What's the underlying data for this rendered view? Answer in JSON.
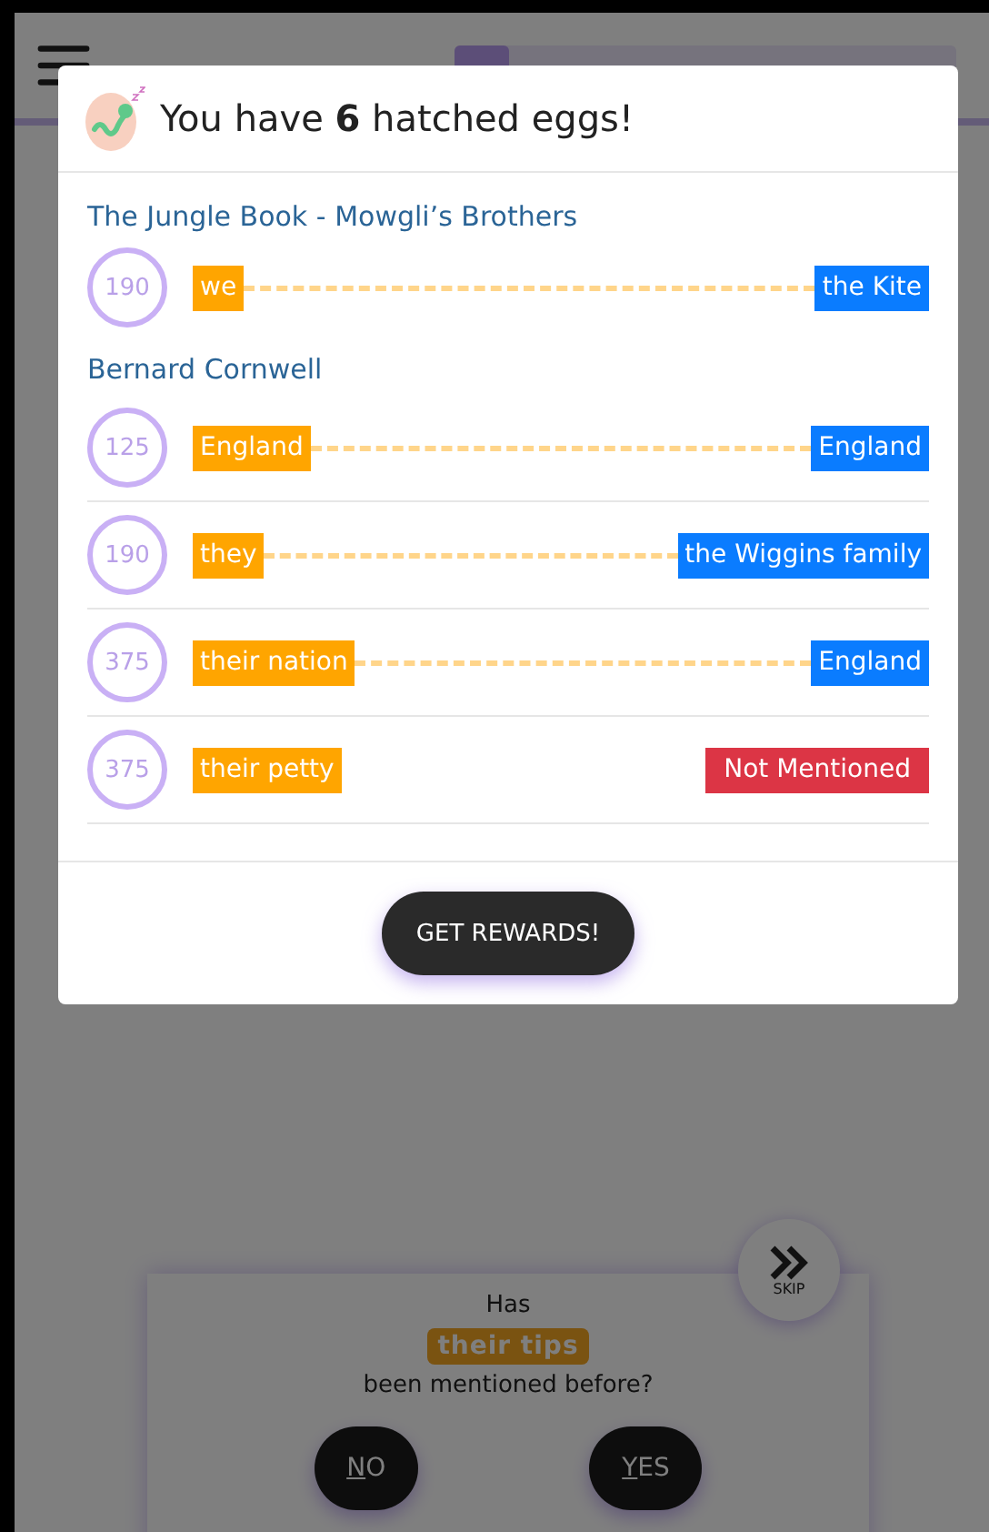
{
  "header": {
    "progress": {
      "level": 0.11
    }
  },
  "modal": {
    "title": "You have **6** hatched eggs!",
    "groups": [
      {
        "title": "The Jungle Book - Mowgli’s Brothers",
        "rows": [
          {
            "score": "190",
            "mention": "we",
            "kind": "match",
            "answer": "the Kite"
          }
        ]
      },
      {
        "title": "Bernard Cornwell",
        "rows": [
          {
            "score": "125",
            "mention": "England",
            "kind": "match",
            "answer": "England"
          },
          {
            "score": "190",
            "mention": "they",
            "kind": "match",
            "answer": "the Wiggins family"
          },
          {
            "score": "375",
            "mention": "their nation",
            "kind": "match",
            "answer": "England"
          },
          {
            "score": "375",
            "mention": "their petty",
            "kind": "not_mentioned",
            "answer": "Not Mentioned"
          }
        ]
      }
    ],
    "button": "GET REWARDS!"
  },
  "question": {
    "before": "Has",
    "mention": "their tips",
    "after": "been mentioned before?",
    "skip": "SKIP",
    "buttons": [
      "NO",
      "YES"
    ]
  }
}
